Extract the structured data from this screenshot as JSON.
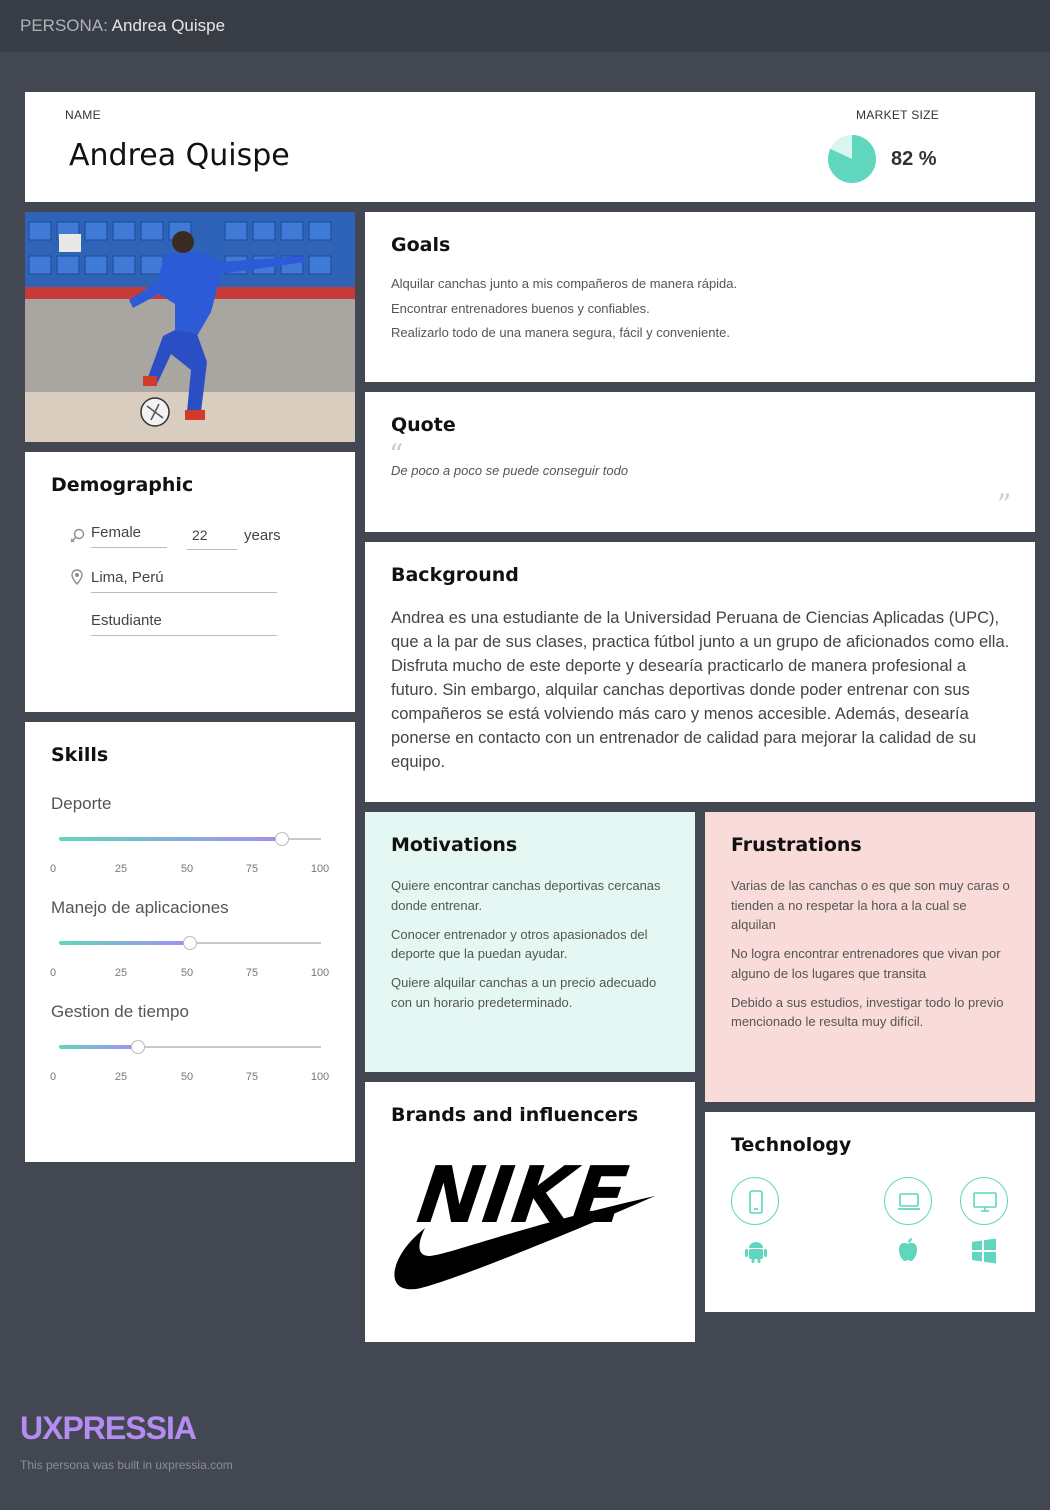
{
  "topbar": {
    "prefix": "PERSONA:",
    "title": "Andrea Quispe"
  },
  "header": {
    "name_label": "NAME",
    "name": "Andrea Quispe",
    "market_label": "MARKET SIZE",
    "market_value": 0.82,
    "market_text": "82 %"
  },
  "demographic": {
    "title": "Demographic",
    "gender": "Female",
    "age": "22",
    "age_unit": "years",
    "location": "Lima, Perú",
    "occupation": "Estudiante"
  },
  "skills": {
    "title": "Skills",
    "tick_labels": [
      "0",
      "25",
      "50",
      "75",
      "100"
    ],
    "items": [
      {
        "name": "Deporte",
        "value": 85
      },
      {
        "name": "Manejo de aplicaciones",
        "value": 50
      },
      {
        "name": "Gestion de tiempo",
        "value": 30
      }
    ]
  },
  "goals": {
    "title": "Goals",
    "items": [
      "Alquilar canchas junto a mis compañeros de manera rápida.",
      "Encontrar entrenadores buenos y confiables.",
      "Realizarlo todo de una manera segura, fácil y conveniente."
    ]
  },
  "quote": {
    "title": "Quote",
    "text": "De poco a poco se puede conseguir todo",
    "open_mark": "“",
    "close_mark": "”"
  },
  "background": {
    "title": "Background",
    "text": "Andrea es una estudiante de la Universidad Peruana de Ciencias Aplicadas (UPC), que a la par de sus clases, practica fútbol junto a un grupo de aficionados como ella. Disfruta mucho de este deporte y desearía practicarlo de manera profesional a futuro. Sin embargo, alquilar canchas deportivas donde poder entrenar con sus compañeros se está volviendo más caro y menos accesible. Además, desearía ponerse en contacto con un entrenador de calidad para mejorar la calidad de su equipo."
  },
  "motivations": {
    "title": "Motivations",
    "items": [
      "Quiere encontrar canchas deportivas cercanas donde entrenar.",
      "Conocer entrenador y otros apasionados del deporte que la puedan ayudar.",
      "Quiere alquilar canchas a un precio adecuado con un horario predeterminado."
    ]
  },
  "frustrations": {
    "title": "Frustrations",
    "items": [
      "Varias de las canchas o es que son muy caras o tienden a no respetar la hora a la cual se alquilan",
      "No logra encontrar entrenadores que vivan por alguno de los lugares que transita",
      "Debido a sus estudios, investigar todo lo previo mencionado le resulta muy difícil."
    ]
  },
  "brands": {
    "title": "Brands and influencers",
    "logo_text": "NIKE"
  },
  "technology": {
    "title": "Technology",
    "devices": [
      "mobile-icon",
      "laptop-icon",
      "desktop-icon"
    ],
    "os": [
      "android-icon",
      "apple-icon",
      "windows-icon"
    ]
  },
  "footer": {
    "logo": "UXPRESSIA",
    "built": "This persona was built in uxpressia.com"
  },
  "colors": {
    "accent": "#5fd6bd",
    "accent2": "#a58df0",
    "motivations_bg": "#e4f7f3",
    "frustrations_bg": "#f9dcda",
    "logo": "#b48cf2"
  }
}
